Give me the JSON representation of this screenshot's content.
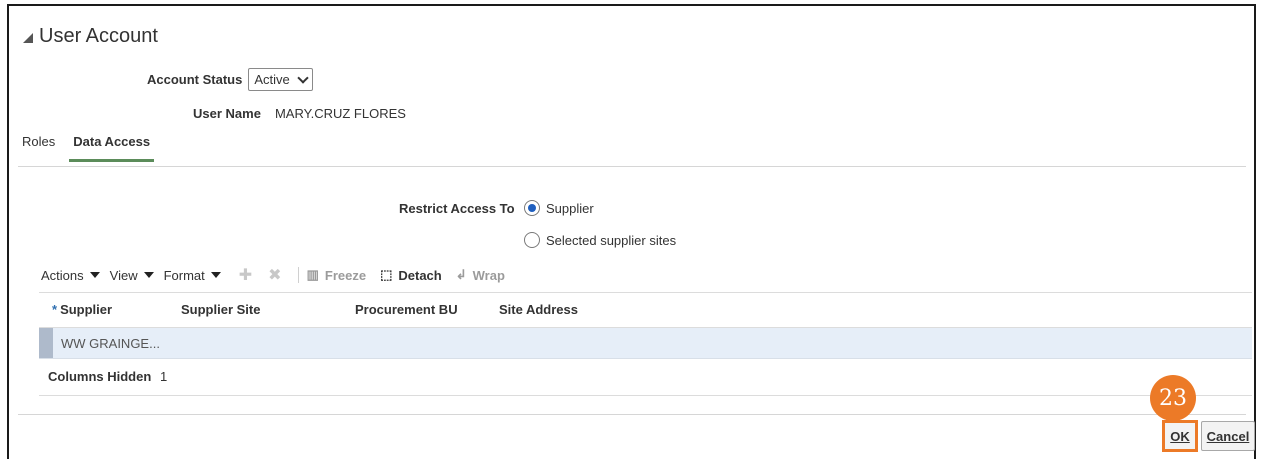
{
  "section": {
    "title": "User Account"
  },
  "account": {
    "status_label": "Account Status",
    "status_value": "Active",
    "user_name_label": "User Name",
    "user_name_value": "MARY.CRUZ FLORES"
  },
  "tabs": [
    {
      "label": "Roles",
      "active": false
    },
    {
      "label": "Data Access",
      "active": true
    }
  ],
  "restrict": {
    "label": "Restrict Access To",
    "options": [
      {
        "label": "Supplier",
        "selected": true
      },
      {
        "label": "Selected supplier sites",
        "selected": false
      }
    ]
  },
  "toolbar": {
    "actions": "Actions",
    "view": "View",
    "format": "Format",
    "add_icon": "plus-icon",
    "delete_icon": "x-icon",
    "freeze": "Freeze",
    "detach": "Detach",
    "wrap": "Wrap"
  },
  "table": {
    "columns": [
      "Supplier",
      "Supplier Site",
      "Procurement BU",
      "Site Address"
    ],
    "rows": [
      {
        "supplier": "WW GRAINGE..."
      }
    ],
    "columns_hidden_label": "Columns Hidden",
    "columns_hidden_value": "1"
  },
  "step_number": "23",
  "buttons": {
    "ok": "OK",
    "cancel": "Cancel"
  },
  "colors": {
    "accent": "#ec7a27",
    "selected_row": "#e6eef8",
    "tab_underline": "#5b8c5a",
    "required": "#2f6fb0"
  }
}
